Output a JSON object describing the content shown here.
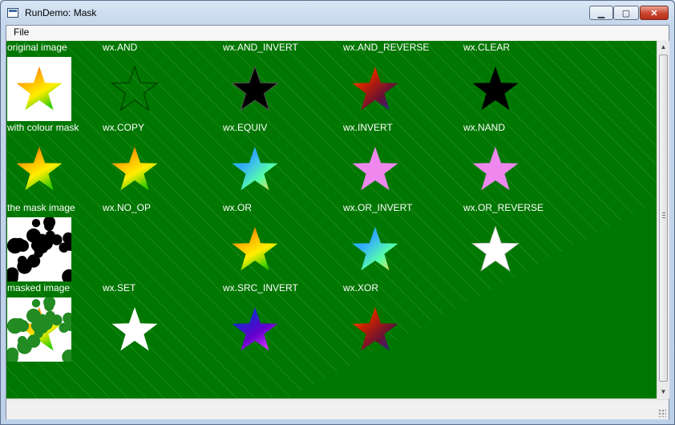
{
  "window": {
    "title": "RunDemo: Mask"
  },
  "menu": {
    "file": "File"
  },
  "colors": {
    "canvas_bg": "#007700",
    "label_text": "#ffffff"
  },
  "cells": [
    {
      "label": "original image",
      "kind": "star-colour-on-white"
    },
    {
      "label": "wx.AND",
      "kind": "star-speckle"
    },
    {
      "label": "wx.AND_INVERT",
      "kind": "star-black"
    },
    {
      "label": "wx.AND_REVERSE",
      "kind": "star-red"
    },
    {
      "label": "wx.CLEAR",
      "kind": "star-black-solid"
    },
    {
      "label": "with colour mask",
      "kind": "star-colour"
    },
    {
      "label": "wx.COPY",
      "kind": "star-colour"
    },
    {
      "label": "wx.EQUIV",
      "kind": "star-cyan"
    },
    {
      "label": "wx.INVERT",
      "kind": "star-pink"
    },
    {
      "label": "wx.NAND",
      "kind": "star-pink"
    },
    {
      "label": "the mask image",
      "kind": "mask-dots"
    },
    {
      "label": "wx.NO_OP",
      "kind": "empty"
    },
    {
      "label": "wx.OR",
      "kind": "star-colour"
    },
    {
      "label": "wx.OR_INVERT",
      "kind": "star-cyan"
    },
    {
      "label": "wx.OR_REVERSE",
      "kind": "star-white-outline"
    },
    {
      "label": "masked image",
      "kind": "masked-dots"
    },
    {
      "label": "wx.SET",
      "kind": "star-white"
    },
    {
      "label": "wx.SRC_INVERT",
      "kind": "star-blue"
    },
    {
      "label": "wx.XOR",
      "kind": "star-red"
    }
  ]
}
